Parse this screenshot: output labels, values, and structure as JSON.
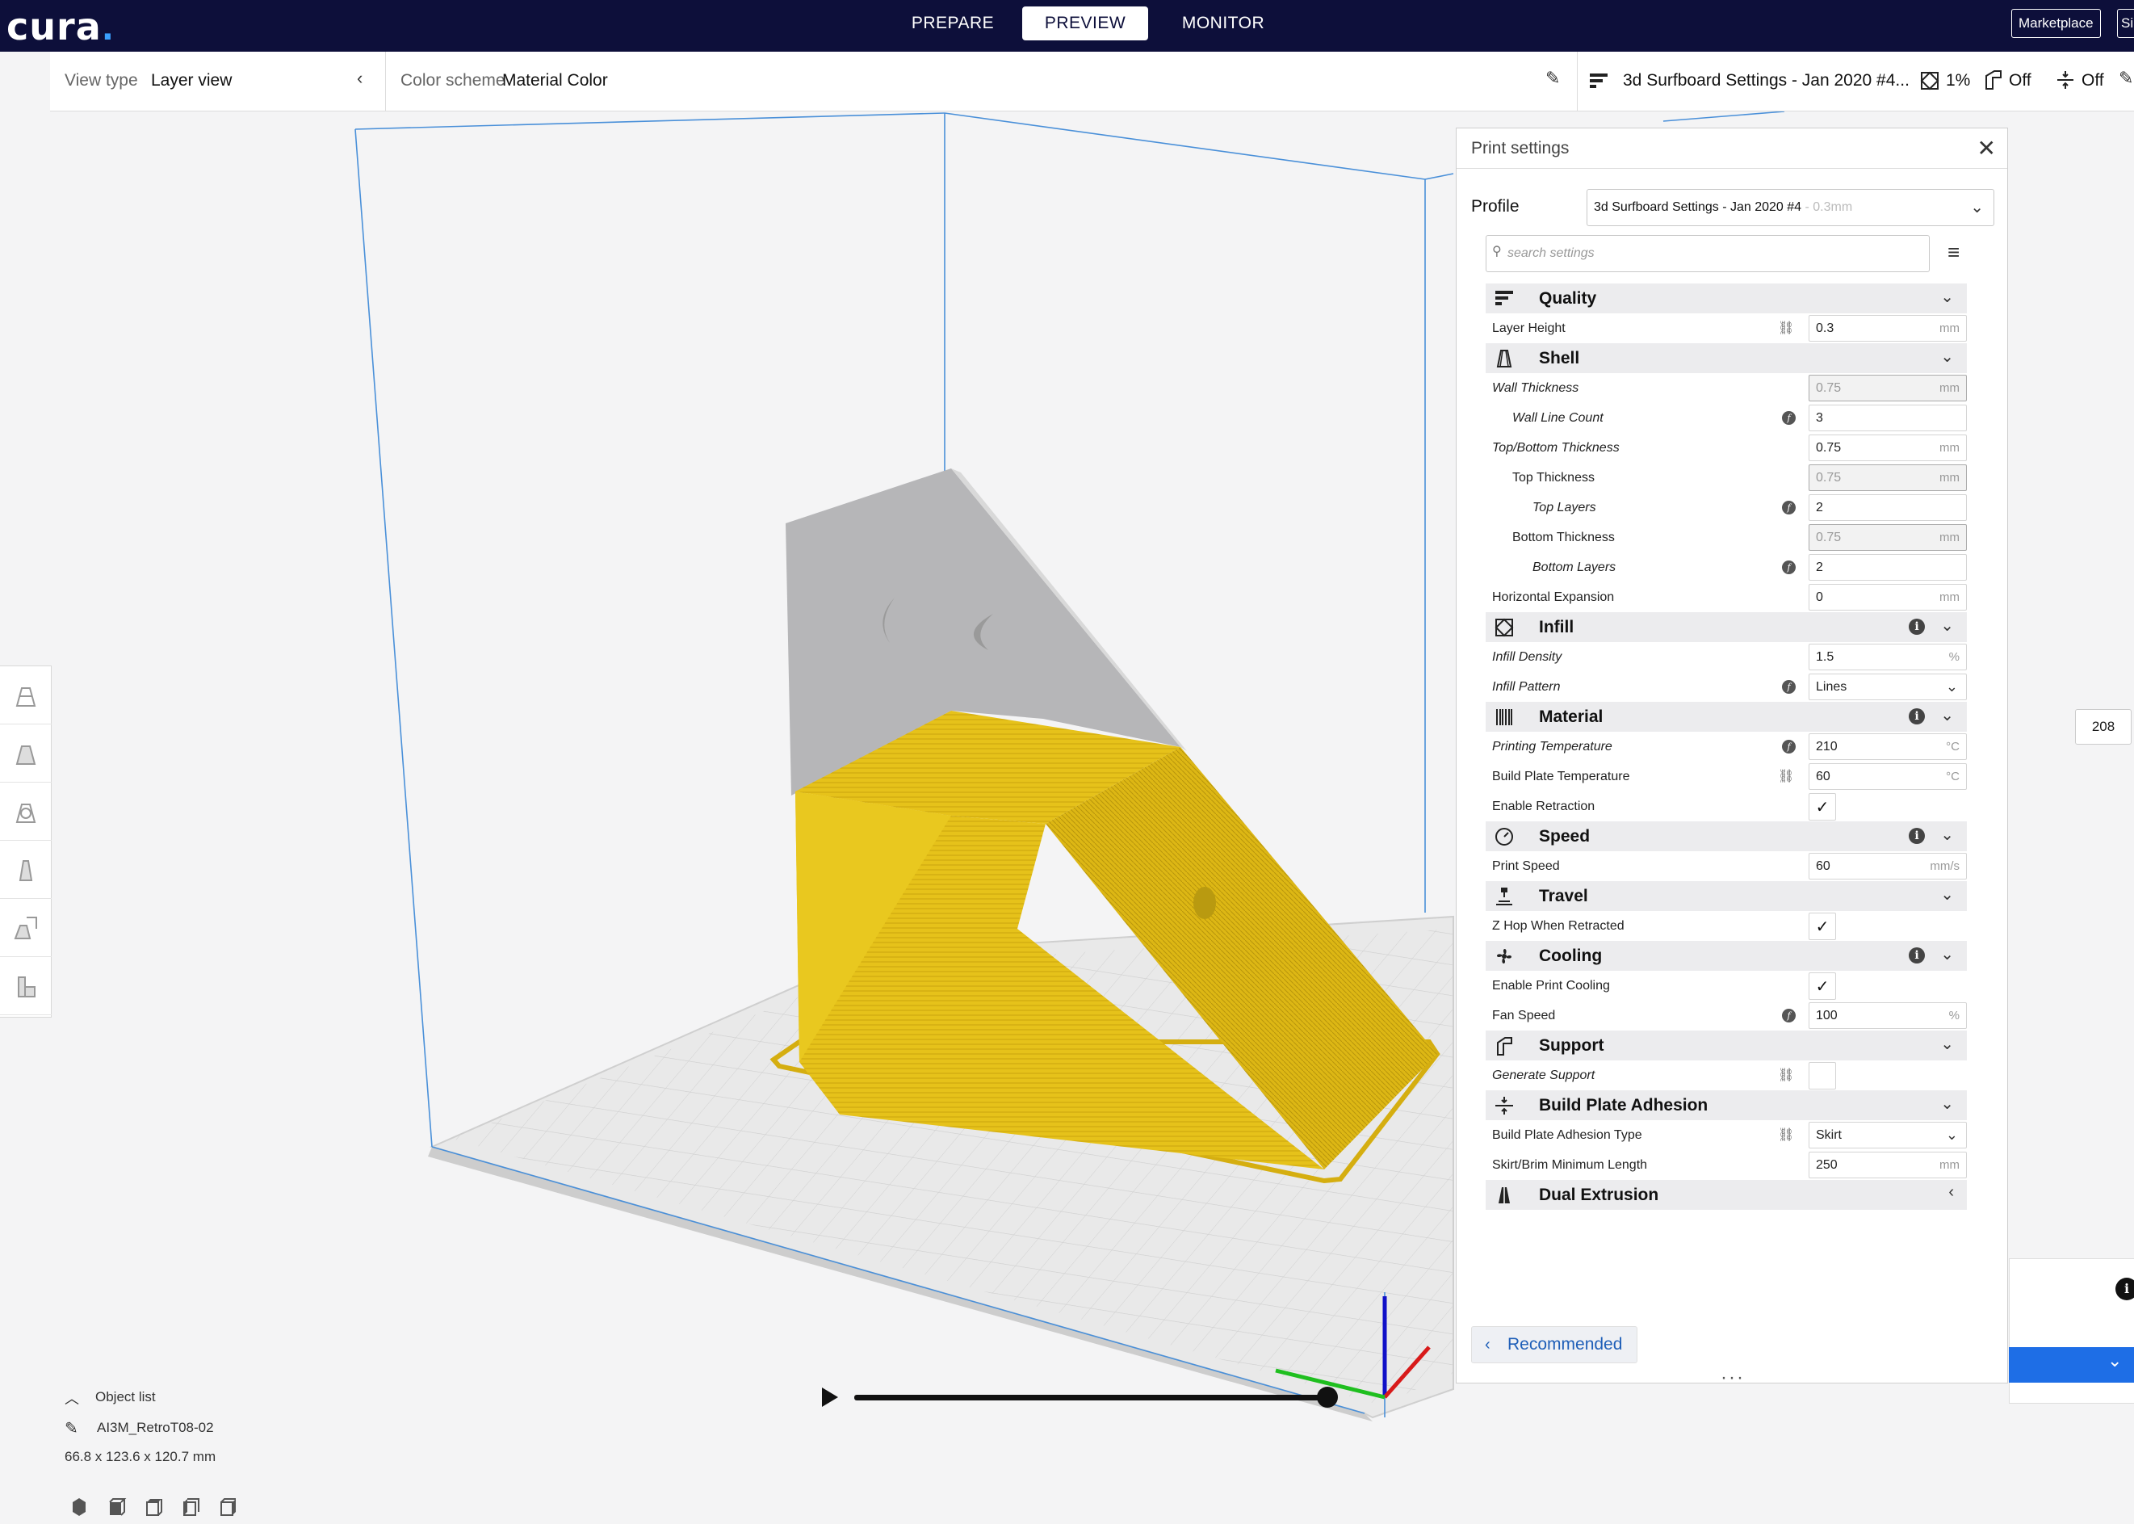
{
  "topbar": {
    "logo": "cura",
    "stages": [
      "PREPARE",
      "PREVIEW",
      "MONITOR"
    ],
    "marketplace": "Marketplace",
    "signin_partial": "Si"
  },
  "viewbar": {
    "view_type_label": "View type",
    "view_type_value": "Layer view",
    "color_scheme_label": "Color scheme",
    "color_scheme_value": "Material Color",
    "profile_summary": "3d Surfboard Settings - Jan 2020 #4...",
    "infill_value": "1%",
    "support_value": "Off",
    "adhesion_value": "Off"
  },
  "object_list": {
    "header": "Object list",
    "object_name": "AI3M_RetroT08-02",
    "dimensions": "66.8 x 123.6 x 120.7 mm"
  },
  "print_settings": {
    "title": "Print settings",
    "profile_label": "Profile",
    "profile_name": "3d Surfboard Settings - Jan 2020 #4",
    "profile_suffix": " - 0.3mm",
    "search_placeholder": "search settings",
    "recommended_label": "Recommended",
    "categories": [
      {
        "title": "Quality",
        "icon": "quality-icon",
        "info": false,
        "chevron": "down",
        "rows": [
          {
            "label": "Layer Height",
            "indent": 0,
            "italic": false,
            "marker": "link",
            "type": "input",
            "value": "0.3",
            "unit": "mm",
            "disabled": false
          }
        ]
      },
      {
        "title": "Shell",
        "icon": "shell-icon",
        "info": false,
        "chevron": "down",
        "rows": [
          {
            "label": "Wall Thickness",
            "indent": 0,
            "italic": true,
            "marker": "",
            "type": "input",
            "value": "0.75",
            "unit": "mm",
            "disabled": true
          },
          {
            "label": "Wall Line Count",
            "indent": 1,
            "italic": true,
            "marker": "fx",
            "type": "input",
            "value": "3",
            "unit": "",
            "disabled": false
          },
          {
            "label": "Top/Bottom Thickness",
            "indent": 0,
            "italic": true,
            "marker": "",
            "type": "input",
            "value": "0.75",
            "unit": "mm",
            "disabled": false
          },
          {
            "label": "Top Thickness",
            "indent": 1,
            "italic": false,
            "marker": "",
            "type": "input",
            "value": "0.75",
            "unit": "mm",
            "disabled": true
          },
          {
            "label": "Top Layers",
            "indent": 2,
            "italic": true,
            "marker": "fx",
            "type": "input",
            "value": "2",
            "unit": "",
            "disabled": false
          },
          {
            "label": "Bottom Thickness",
            "indent": 1,
            "italic": false,
            "marker": "",
            "type": "input",
            "value": "0.75",
            "unit": "mm",
            "disabled": true
          },
          {
            "label": "Bottom Layers",
            "indent": 2,
            "italic": true,
            "marker": "fx",
            "type": "input",
            "value": "2",
            "unit": "",
            "disabled": false
          },
          {
            "label": "Horizontal Expansion",
            "indent": 0,
            "italic": false,
            "marker": "",
            "type": "input",
            "value": "0",
            "unit": "mm",
            "disabled": false
          }
        ]
      },
      {
        "title": "Infill",
        "icon": "infill-icon",
        "info": true,
        "chevron": "down",
        "rows": [
          {
            "label": "Infill Density",
            "indent": 0,
            "italic": true,
            "marker": "",
            "type": "input",
            "value": "1.5",
            "unit": "%",
            "disabled": false
          },
          {
            "label": "Infill Pattern",
            "indent": 0,
            "italic": true,
            "marker": "fx",
            "type": "select",
            "value": "Lines",
            "unit": "",
            "disabled": false
          }
        ]
      },
      {
        "title": "Material",
        "icon": "material-icon",
        "info": true,
        "chevron": "down",
        "rows": [
          {
            "label": "Printing Temperature",
            "indent": 0,
            "italic": true,
            "marker": "fx",
            "type": "input",
            "value": "210",
            "unit": "°C",
            "disabled": false
          },
          {
            "label": "Build Plate Temperature",
            "indent": 0,
            "italic": false,
            "marker": "link",
            "type": "input",
            "value": "60",
            "unit": "°C",
            "disabled": false
          },
          {
            "label": "Enable Retraction",
            "indent": 0,
            "italic": false,
            "marker": "",
            "type": "check",
            "value": "✓",
            "unit": "",
            "disabled": false
          }
        ]
      },
      {
        "title": "Speed",
        "icon": "speed-icon",
        "info": true,
        "chevron": "down",
        "rows": [
          {
            "label": "Print Speed",
            "indent": 0,
            "italic": false,
            "marker": "",
            "type": "input",
            "value": "60",
            "unit": "mm/s",
            "disabled": false
          }
        ]
      },
      {
        "title": "Travel",
        "icon": "travel-icon",
        "info": false,
        "chevron": "down",
        "rows": [
          {
            "label": "Z Hop When Retracted",
            "indent": 0,
            "italic": false,
            "marker": "",
            "type": "check",
            "value": "✓",
            "unit": "",
            "disabled": false
          }
        ]
      },
      {
        "title": "Cooling",
        "icon": "cooling-icon",
        "info": true,
        "chevron": "down",
        "rows": [
          {
            "label": "Enable Print Cooling",
            "indent": 0,
            "italic": false,
            "marker": "",
            "type": "check",
            "value": "✓",
            "unit": "",
            "disabled": false
          },
          {
            "label": "Fan Speed",
            "indent": 0,
            "italic": false,
            "marker": "fx",
            "type": "input",
            "value": "100",
            "unit": "%",
            "disabled": false
          }
        ]
      },
      {
        "title": "Support",
        "icon": "support-icon",
        "info": false,
        "chevron": "down",
        "rows": [
          {
            "label": "Generate Support",
            "indent": 0,
            "italic": true,
            "marker": "link",
            "type": "check",
            "value": "",
            "unit": "",
            "disabled": false
          }
        ]
      },
      {
        "title": "Build Plate Adhesion",
        "icon": "adhesion-icon",
        "info": false,
        "chevron": "down",
        "rows": [
          {
            "label": "Build Plate Adhesion Type",
            "indent": 0,
            "italic": false,
            "marker": "link",
            "type": "select",
            "value": "Skirt",
            "unit": "",
            "disabled": false
          },
          {
            "label": "Skirt/Brim Minimum Length",
            "indent": 0,
            "italic": false,
            "marker": "",
            "type": "input",
            "value": "250",
            "unit": "mm",
            "disabled": false
          }
        ]
      },
      {
        "title": "Dual Extrusion",
        "icon": "dual-extrusion-icon",
        "info": false,
        "chevron": "left",
        "rows": []
      }
    ]
  },
  "layer_slider": {
    "value": "208"
  },
  "colors": {
    "topbar": "#0d0f3a",
    "model": "#e6c21a",
    "accent": "#1e6ee6"
  }
}
